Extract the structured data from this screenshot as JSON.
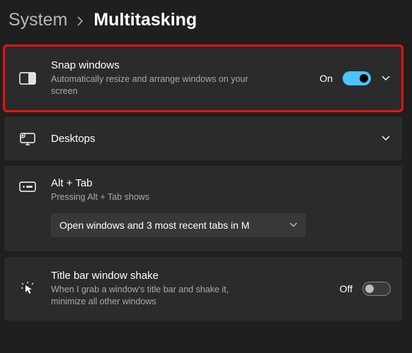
{
  "breadcrumb": {
    "parent": "System",
    "current": "Multitasking"
  },
  "sections": {
    "snap": {
      "title": "Snap windows",
      "desc": "Automatically resize and arrange windows on your screen",
      "state_label": "On",
      "toggle_on": true
    },
    "desktops": {
      "title": "Desktops"
    },
    "alttab": {
      "title": "Alt + Tab",
      "desc": "Pressing Alt + Tab shows",
      "dropdown_value": "Open windows and 3 most recent tabs in M"
    },
    "shake": {
      "title": "Title bar window shake",
      "desc": "When I grab a window's title bar and shake it, minimize all other windows",
      "state_label": "Off",
      "toggle_on": false
    }
  }
}
